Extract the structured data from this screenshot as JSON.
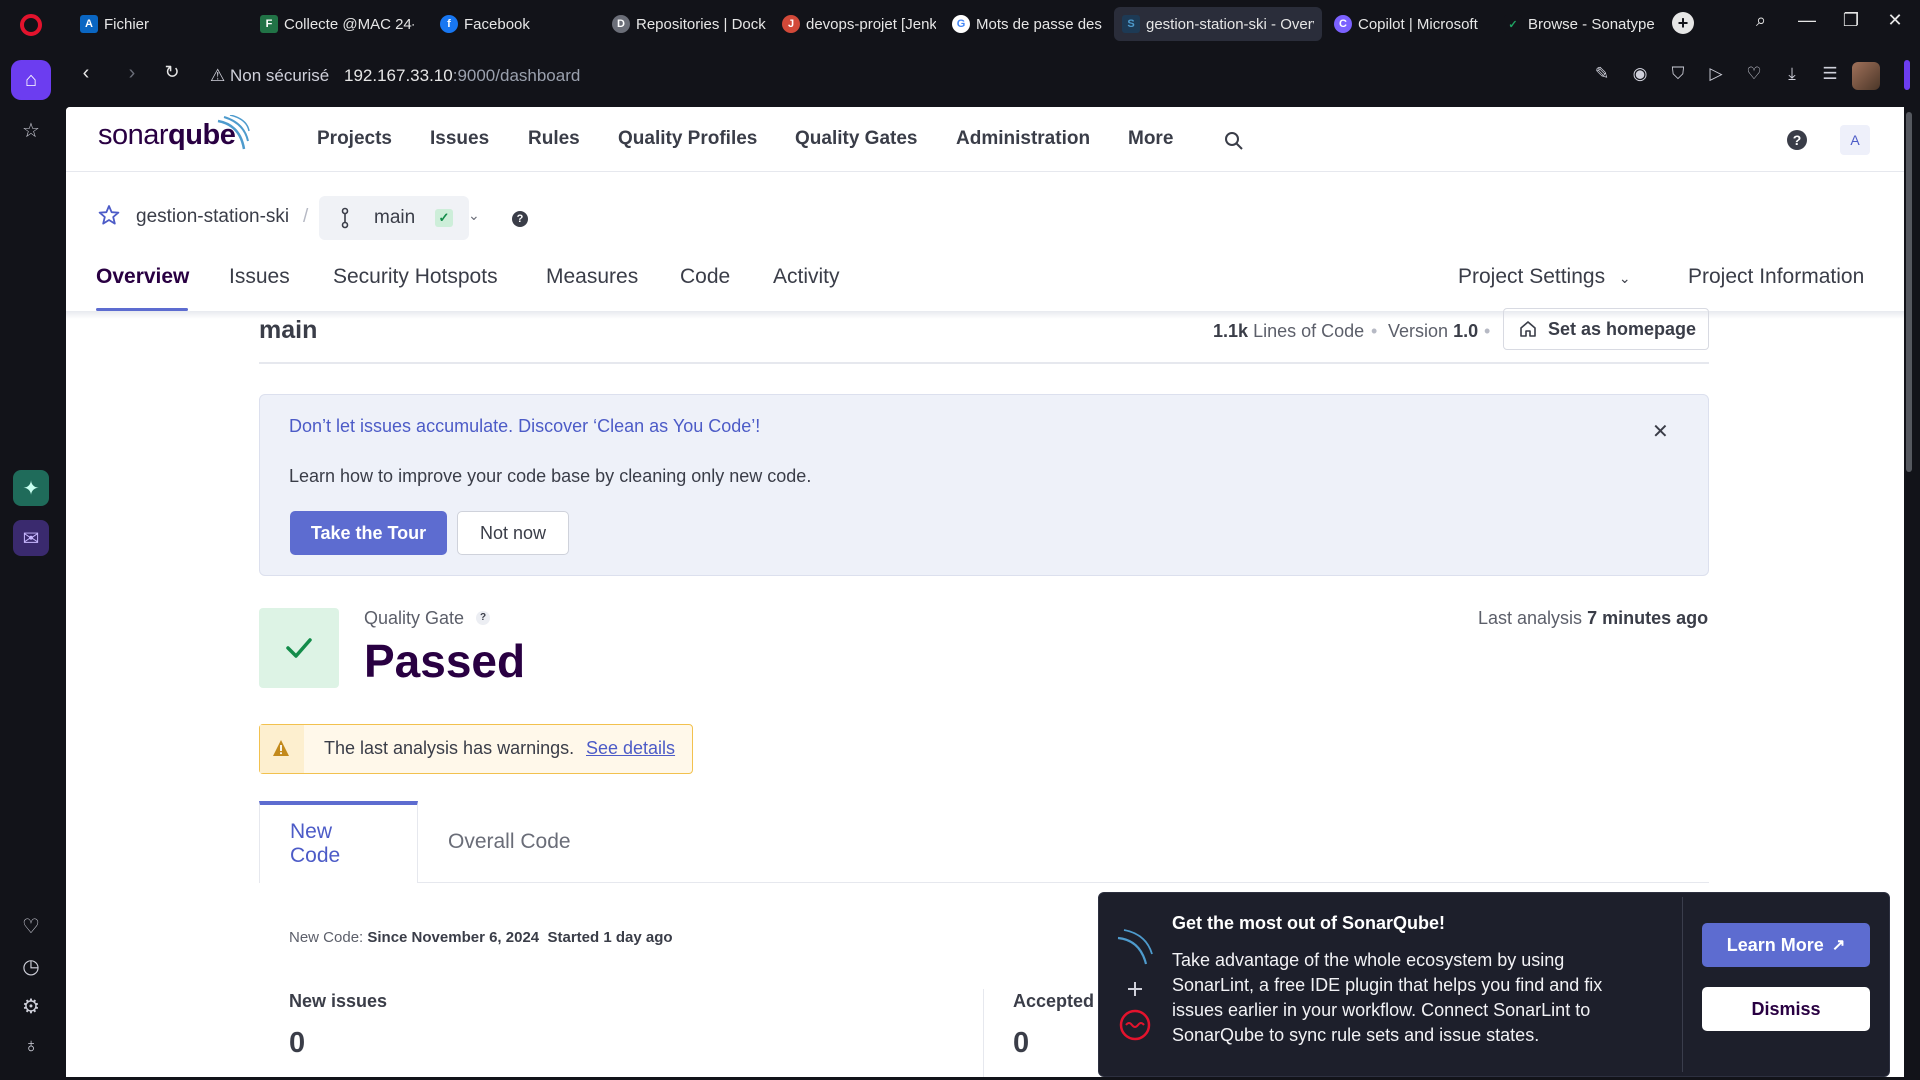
{
  "browser": {
    "tabs": [
      {
        "title": "Fichier",
        "favicon": "azure-icon",
        "color": "#0a66c2",
        "glyph": "A"
      },
      {
        "title": "Collecte @MAC 24-",
        "favicon": "forms-icon",
        "color": "#217346",
        "glyph": "F"
      },
      {
        "title": "Facebook",
        "favicon": "facebook-icon",
        "color": "#1877f2",
        "glyph": "f"
      },
      {
        "title": "Repositories | Docke",
        "favicon": "docker-icon",
        "color": "#6b6e78",
        "glyph": "D"
      },
      {
        "title": "devops-projet [Jenk",
        "favicon": "jenkins-icon",
        "color": "#d24939",
        "glyph": "J"
      },
      {
        "title": "Mots de passe des a",
        "favicon": "google-icon",
        "color": "#ffffff",
        "glyph": "G"
      },
      {
        "title": "gestion-station-ski - Overv",
        "favicon": "sonarqube-icon",
        "color": "#4e9bcd",
        "glyph": "S"
      },
      {
        "title": "Copilot | Microsoft",
        "favicon": "copilot-icon",
        "color": "#7b61ff",
        "glyph": "C"
      },
      {
        "title": "Browse - Sonatype",
        "favicon": "sonatype-icon",
        "color": "#1fa463",
        "glyph": "N"
      }
    ],
    "address": {
      "security_label": "Non sécurisé",
      "host": "192.167.33.10",
      "path": ":9000/dashboard"
    }
  },
  "sonar": {
    "logo_text_a": "sonar",
    "logo_text_b": "qube",
    "nav": [
      "Projects",
      "Issues",
      "Rules",
      "Quality Profiles",
      "Quality Gates",
      "Administration",
      "More"
    ],
    "user_initial": "A",
    "help_glyph": "?",
    "project_name": "gestion-station-ski",
    "breadcrumb_sep": "/",
    "branch": "main",
    "tabs": [
      "Overview",
      "Issues",
      "Security Hotspots",
      "Measures",
      "Code",
      "Activity"
    ],
    "project_settings": "Project Settings",
    "project_information": "Project Information"
  },
  "overview": {
    "branch_title": "main",
    "lines_value": "1.1k",
    "lines_label": "Lines of Code",
    "version_label": "Version",
    "version_value": "1.0",
    "homepage_button": "Set as homepage",
    "banner": {
      "title": "Don’t let issues accumulate. Discover ‘Clean as You Code’!",
      "text": "Learn how to improve your code base by cleaning only new code.",
      "tour_button": "Take the Tour",
      "not_now_button": "Not now"
    },
    "quality_gate": {
      "label": "Quality Gate",
      "status": "Passed",
      "status_color": "#138c4a",
      "last_analysis_label": "Last analysis",
      "last_analysis_value": "7 minutes ago"
    },
    "warning": {
      "text": "The last analysis has warnings.",
      "link": "See details"
    },
    "code_tabs": [
      "New Code",
      "Overall Code"
    ],
    "new_code": {
      "label": "New Code:",
      "since": "Since November 6, 2024",
      "started": "Started 1 day ago"
    },
    "metrics": [
      {
        "label": "New issues",
        "value": "0"
      },
      {
        "label": "Accepted",
        "value": "0"
      }
    ]
  },
  "toast": {
    "title": "Get the most out of SonarQube!",
    "body": "Take advantage of the whole ecosystem by using SonarLint, a free IDE plugin that helps you find and fix issues earlier in your workflow. Connect SonarLint to SonarQube to sync rule sets and issue states.",
    "learn_more": "Learn More",
    "dismiss": "Dismiss"
  },
  "colors": {
    "accent": "#5d6cd0",
    "brand_dark": "#290042",
    "opera_red": "#e3132d",
    "warning": "#f2c14e"
  }
}
